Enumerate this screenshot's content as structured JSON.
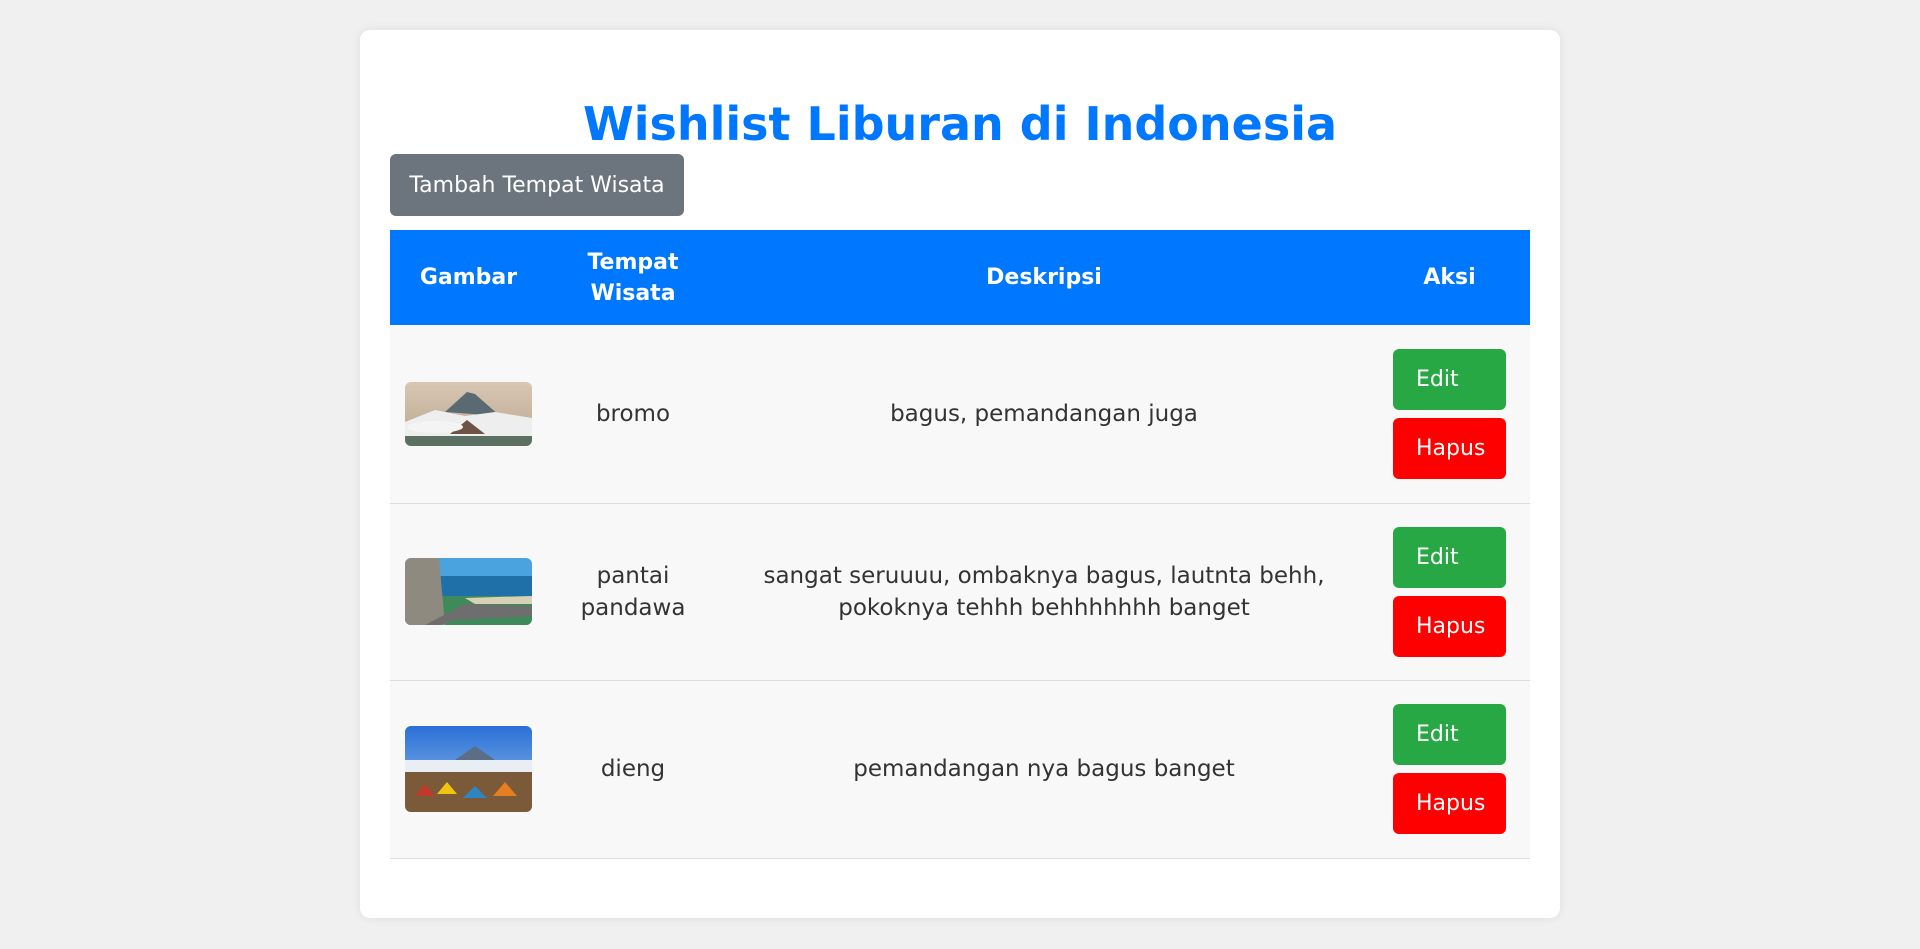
{
  "title": "Wishlist Liburan di Indonesia",
  "add_button": "Tambah Tempat Wisata",
  "table": {
    "headers": [
      "Gambar",
      "Tempat Wisata",
      "Deskripsi",
      "Aksi"
    ],
    "rows": [
      {
        "place": "bromo",
        "description": "bagus, pemandangan juga",
        "edit": "Edit",
        "delete": "Hapus"
      },
      {
        "place": "pantai pandawa",
        "description": "sangat seruuuu, ombaknya bagus, lautnta behh, pokoknya tehhh behhhhhhh banget",
        "edit": "Edit",
        "delete": "Hapus"
      },
      {
        "place": "dieng",
        "description": "pemandangan nya bagus banget",
        "edit": "Edit",
        "delete": "Hapus"
      }
    ]
  },
  "colors": {
    "title": "#0077ff",
    "header_bg": "#0077ff",
    "add_button": "#6c757d",
    "edit_button": "#28a745",
    "delete_button": "#ff0000"
  }
}
